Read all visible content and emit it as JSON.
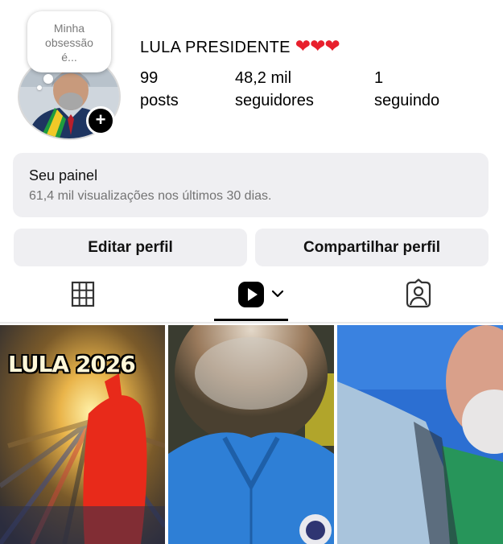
{
  "profile": {
    "note": [
      "Minha",
      "obsessão",
      "é..."
    ],
    "name": "LULA PRESIDENTE",
    "hearts": "❤❤❤",
    "add_badge": "+",
    "stats": [
      {
        "value": "99",
        "label": "posts"
      },
      {
        "value": "48,2 mil",
        "label": "seguidores"
      },
      {
        "value": "1",
        "label": "seguindo"
      }
    ]
  },
  "dashboard": {
    "title": "Seu painel",
    "subtitle": "61,4 mil visualizações nos últimos 30 dias."
  },
  "buttons": {
    "edit": "Editar perfil",
    "share": "Compartilhar perfil"
  },
  "tabs": [
    {
      "icon": "grid-icon",
      "active": false
    },
    {
      "icon": "reels-icon",
      "active": true
    },
    {
      "icon": "tagged-icon",
      "active": false
    }
  ],
  "grid": {
    "post1_overlay": "LULA 2026"
  },
  "colors": {
    "hearts": "#e8202d",
    "panel_bg": "#efeff2",
    "secondary_text": "#737373"
  }
}
